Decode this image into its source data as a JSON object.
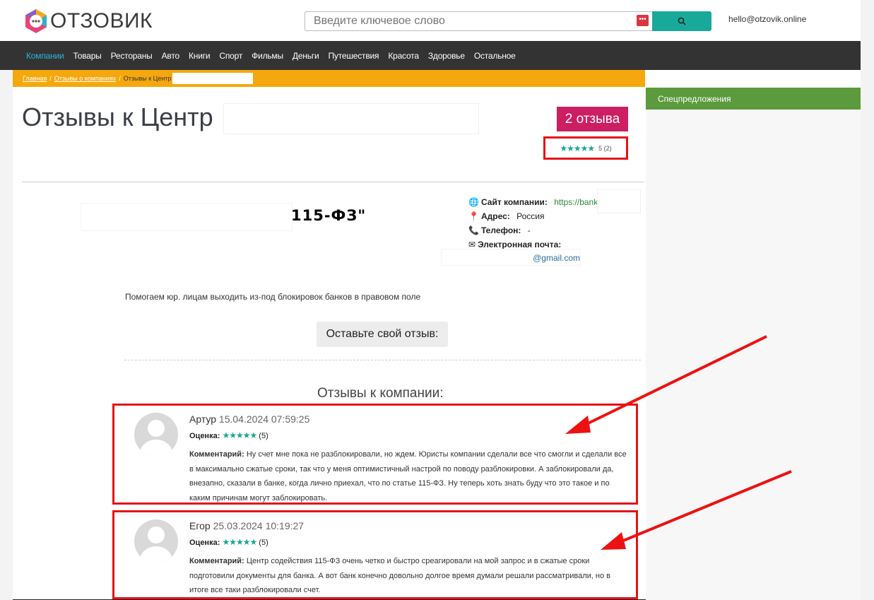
{
  "header": {
    "logo_text": "ОТЗОВИК",
    "search_placeholder": "Введите ключевое слово",
    "email": "hello@otzovik.online"
  },
  "nav": {
    "items": [
      "Компании",
      "Товары",
      "Рестораны",
      "Авто",
      "Книги",
      "Спорт",
      "Фильмы",
      "Деньги",
      "Путешествия",
      "Красота",
      "Здоровье",
      "Остальное"
    ]
  },
  "breadcrumb": {
    "home": "Главная",
    "section": "Отзывы о компаниях",
    "current": "Отзывы к Центр"
  },
  "sidebar": {
    "title": "Спецпредложения"
  },
  "company": {
    "title": "Отзывы к Центр",
    "reviews_count": "2 отзыва",
    "rating_stars": "★★★★★",
    "rating_text": "5 (2)",
    "logo_caption": "115-ФЗ\"",
    "site_label": "Сайт компании:",
    "site_value": "https://bank",
    "address_label": "Адрес:",
    "address_value": "Россия",
    "phone_label": "Телефон:",
    "phone_value": "-",
    "email_label": "Электронная почта:",
    "email_value": "@gmail.com",
    "description": "Помогаем юр. лицам выходить из-под блокировок банков в правовом поле",
    "leave_review": "Оставьте свой отзыв:",
    "reviews_heading": "Отзывы к компании:"
  },
  "reviews": [
    {
      "author": "Артур",
      "date": "15.04.2024 07:59:25",
      "score_label": "Оценка:",
      "stars": "★★★★★",
      "score": "(5)",
      "comment_label": "Комментарий:",
      "comment": "Ну счет мне пока не разблокировали, но ждем. Юристы компании сделали все что смогли и сделали все в максимально сжатые сроки, так что у меня оптимистичный настрой по поводу разблокировки. А заблокировали да, внезапно, сказали в банке, когда лично приехал, что по статье 115-ФЗ. Ну теперь хоть знать буду что это такое и по каким причинам могут заблокировать."
    },
    {
      "author": "Егор",
      "date": "25.03.2024 10:19:27",
      "score_label": "Оценка:",
      "stars": "★★★★★",
      "score": "(5)",
      "comment_label": "Комментарий:",
      "comment": "Центр содействия 115-ФЗ очень четко и быстро среагировали на мой запрос и в сжатые сроки подготовили документы для банка. А вот банк конечно довольно долгое время думали решали рассматривали, но в итоге все таки разблокировали счет."
    }
  ],
  "colors": {
    "nav_bg": "#333333",
    "nav_active": "#29b6d8",
    "breadcrumb_bg": "#f5a80d",
    "badge": "#cc1e63",
    "star": "#17a594",
    "highlight": "#e3141a",
    "sidebar_head": "#5b9a3d",
    "search_btn": "#19a99a"
  }
}
